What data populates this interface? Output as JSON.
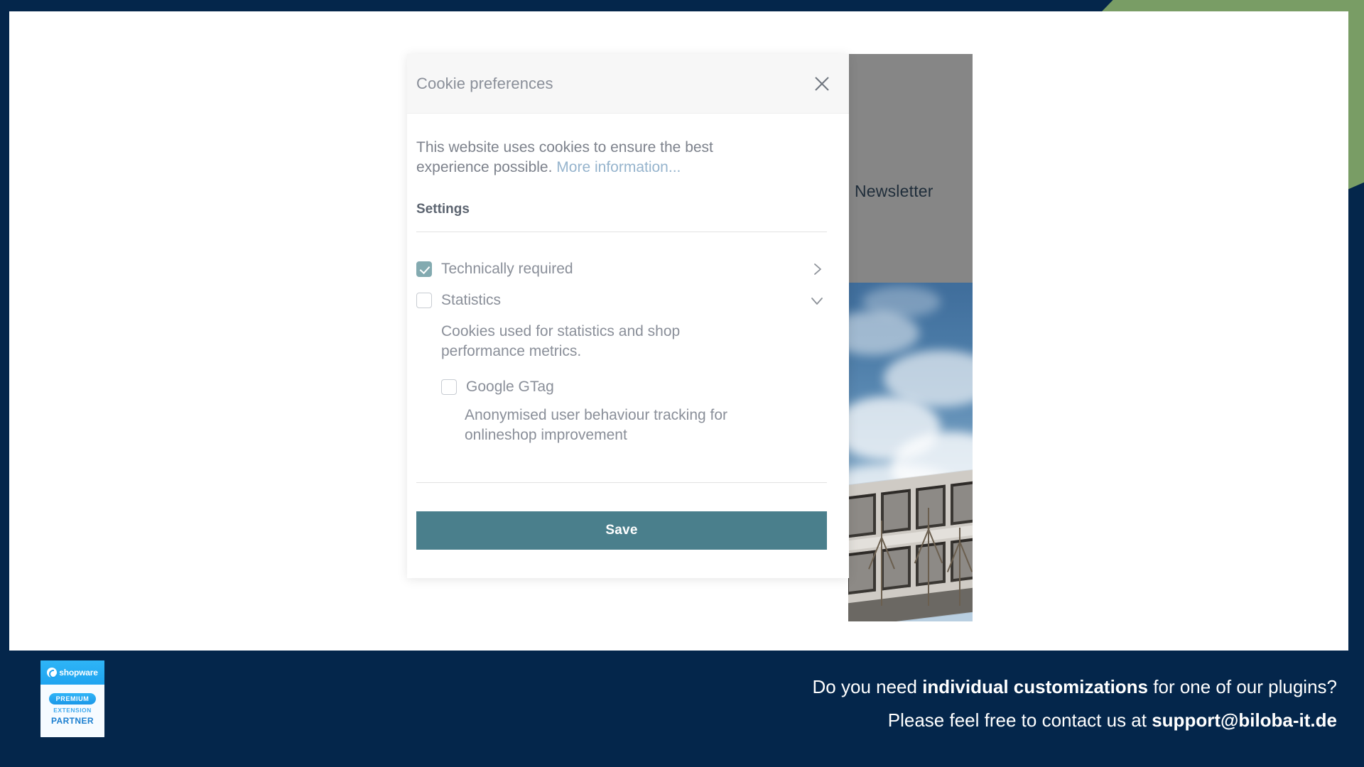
{
  "page": {
    "background_color": "#04264b",
    "accent_color": "#799d65",
    "card_color": "#ffffff"
  },
  "background_content": {
    "newsletter_label": "Newsletter",
    "photo_alt": "modern concrete office building with blue sky and clouds"
  },
  "modal": {
    "title": "Cookie preferences",
    "close_icon": "close-icon",
    "intro_text": "This website uses cookies to ensure the best experience possible. ",
    "intro_link": "More information...",
    "settings_heading": "Settings",
    "accent_color": "#83aab0",
    "save": {
      "label": "Save",
      "color": "#4a7f8c"
    },
    "categories": [
      {
        "label": "Technically required",
        "checked": true,
        "expanded": false,
        "chevron": "chevron-right-icon"
      },
      {
        "label": "Statistics",
        "checked": false,
        "expanded": true,
        "chevron": "chevron-down-icon",
        "description": "Cookies used for statistics and shop performance metrics.",
        "items": [
          {
            "label": "Google GTag",
            "checked": false,
            "description": "Anonymised user behaviour tracking for onlineshop improvement"
          }
        ]
      }
    ]
  },
  "footer": {
    "badge": {
      "brand": "shopware",
      "premium": "PREMIUM",
      "extension": "EXTENSION",
      "partner": "PARTNER"
    },
    "line1_pre": "Do you need ",
    "line1_bold": "individual customizations",
    "line1_post": " for one of our plugins?",
    "line2_pre": "Please feel free to contact us at ",
    "line2_bold": "support@biloba-it.de"
  }
}
